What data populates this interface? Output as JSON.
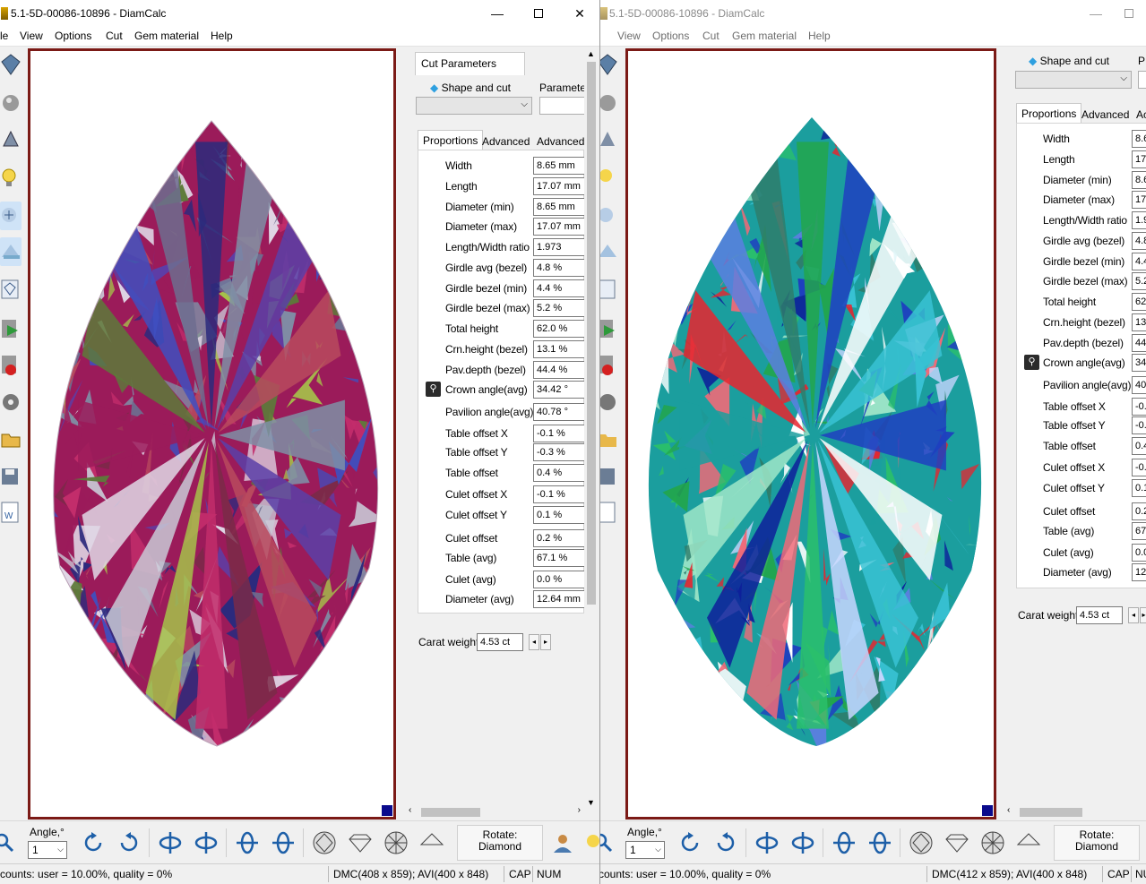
{
  "colors": {
    "frame": "#7b1a16",
    "view_corner": "#0a0a8c",
    "left_stone_palette": [
      "#9b1b5a",
      "#c22d6b",
      "#7f8fa6",
      "#5d7a3a",
      "#a6c24a",
      "#5b3fa8",
      "#3f4fbf",
      "#c9c9d6",
      "#b84a5e",
      "#6d6d8f",
      "#e0d8e6",
      "#7a2a48",
      "#2c2a7d"
    ],
    "right_stone_palette": [
      "#1b9e9e",
      "#2abf6b",
      "#1e3fbf",
      "#e8242e",
      "#f06a78",
      "#ffffff",
      "#5b7fe0",
      "#0d1f9a",
      "#38c2d4",
      "#2e7d6b",
      "#9fe6c8",
      "#c8d6ff",
      "#22a64b"
    ]
  },
  "left_window": {
    "title": "5.1-5D-00086-10896 - DiamCalc",
    "menu": [
      "le",
      "View",
      "Options",
      "Cut",
      "Gem material",
      "Help"
    ],
    "panel": {
      "group_tab": "Cut Parameters",
      "shape_label": "Shape and cut",
      "parameter_label": "Parameter",
      "subtabs": [
        "Proportions",
        "Advanced",
        "Advanced"
      ],
      "params": [
        {
          "label": "Width",
          "value": "8.65 mm"
        },
        {
          "label": "Length",
          "value": "17.07 mm"
        },
        {
          "label": "Diameter (min)",
          "value": "8.65 mm"
        },
        {
          "label": "Diameter (max)",
          "value": "17.07 mm"
        },
        {
          "label": "Length/Width ratio",
          "value": "1.973"
        },
        {
          "label": "Girdle avg (bezel)",
          "value": "4.8 %"
        },
        {
          "label": "Girdle bezel (min)",
          "value": "4.4 %"
        },
        {
          "label": "Girdle bezel (max)",
          "value": "5.2 %"
        },
        {
          "label": "Total height",
          "value": "62.0 %"
        },
        {
          "label": "Crn.height (bezel)",
          "value": "13.1 %"
        },
        {
          "label": "Pav.depth (bezel)",
          "value": "44.4 %"
        },
        {
          "label": "Crown angle(avg)",
          "value": "34.42 °"
        },
        {
          "label": "Pavilion angle(avg)",
          "value": "40.78 °"
        },
        {
          "label": "Table offset X",
          "value": "-0.1 %"
        },
        {
          "label": "Table offset Y",
          "value": "-0.3 %"
        },
        {
          "label": "Table offset",
          "value": "0.4 %"
        },
        {
          "label": "Culet offset X",
          "value": "-0.1 %"
        },
        {
          "label": "Culet offset Y",
          "value": "0.1 %"
        },
        {
          "label": "Culet offset",
          "value": "0.2 %"
        },
        {
          "label": "Table (avg)",
          "value": "67.1 %"
        },
        {
          "label": "Culet (avg)",
          "value": "0.0 %"
        },
        {
          "label": "Diameter (avg)",
          "value": "12.64 mm"
        }
      ],
      "carat_label": "Carat weight",
      "carat_value": "4.53 ct"
    },
    "bottom": {
      "angle_label": "Angle,°",
      "angle_value": "1",
      "rotate_line1": "Rotate:",
      "rotate_line2": "Diamond"
    },
    "status": {
      "counts": "counts: user = 10.00%, quality = 0%",
      "dmc": "DMC(408 x 859); AVI(400 x 848)",
      "cap": "CAP",
      "num": "NUM"
    }
  },
  "right_window": {
    "title": "5.1-5D-00086-10896 - DiamCalc",
    "menu": [
      "View",
      "Options",
      "Cut",
      "Gem material",
      "Help"
    ],
    "panel": {
      "shape_label": "Shape and cut",
      "parameter_label": "P",
      "subtabs": [
        "Proportions",
        "Advanced",
        "Ac"
      ],
      "params": [
        {
          "label": "Width",
          "value": "8.6"
        },
        {
          "label": "Length",
          "value": "17"
        },
        {
          "label": "Diameter (min)",
          "value": "8.6"
        },
        {
          "label": "Diameter (max)",
          "value": "17"
        },
        {
          "label": "Length/Width ratio",
          "value": "1.9"
        },
        {
          "label": "Girdle avg (bezel)",
          "value": "4.8"
        },
        {
          "label": "Girdle bezel (min)",
          "value": "4.4"
        },
        {
          "label": "Girdle bezel (max)",
          "value": "5.2"
        },
        {
          "label": "Total height",
          "value": "62"
        },
        {
          "label": "Crn.height (bezel)",
          "value": "13"
        },
        {
          "label": "Pav.depth (bezel)",
          "value": "44"
        },
        {
          "label": "Crown angle(avg)",
          "value": "34"
        },
        {
          "label": "Pavilion angle(avg)",
          "value": "40"
        },
        {
          "label": "Table offset X",
          "value": "-0."
        },
        {
          "label": "Table offset Y",
          "value": "-0."
        },
        {
          "label": "Table offset",
          "value": "0.4"
        },
        {
          "label": "Culet offset X",
          "value": "-0."
        },
        {
          "label": "Culet offset Y",
          "value": "0.1"
        },
        {
          "label": "Culet offset",
          "value": "0.2"
        },
        {
          "label": "Table (avg)",
          "value": "67"
        },
        {
          "label": "Culet (avg)",
          "value": "0.0"
        },
        {
          "label": "Diameter (avg)",
          "value": "12"
        }
      ],
      "carat_label": "Carat weight",
      "carat_value": "4.53 ct"
    },
    "bottom": {
      "angle_label": "Angle,°",
      "angle_value": "1",
      "rotate_line1": "Rotate:",
      "rotate_line2": "Diamond"
    },
    "status": {
      "counts": "counts: user = 10.00%, quality = 0%",
      "dmc": "DMC(412 x 859); AVI(400 x 848)",
      "cap": "CAP",
      "num": "NU"
    }
  }
}
